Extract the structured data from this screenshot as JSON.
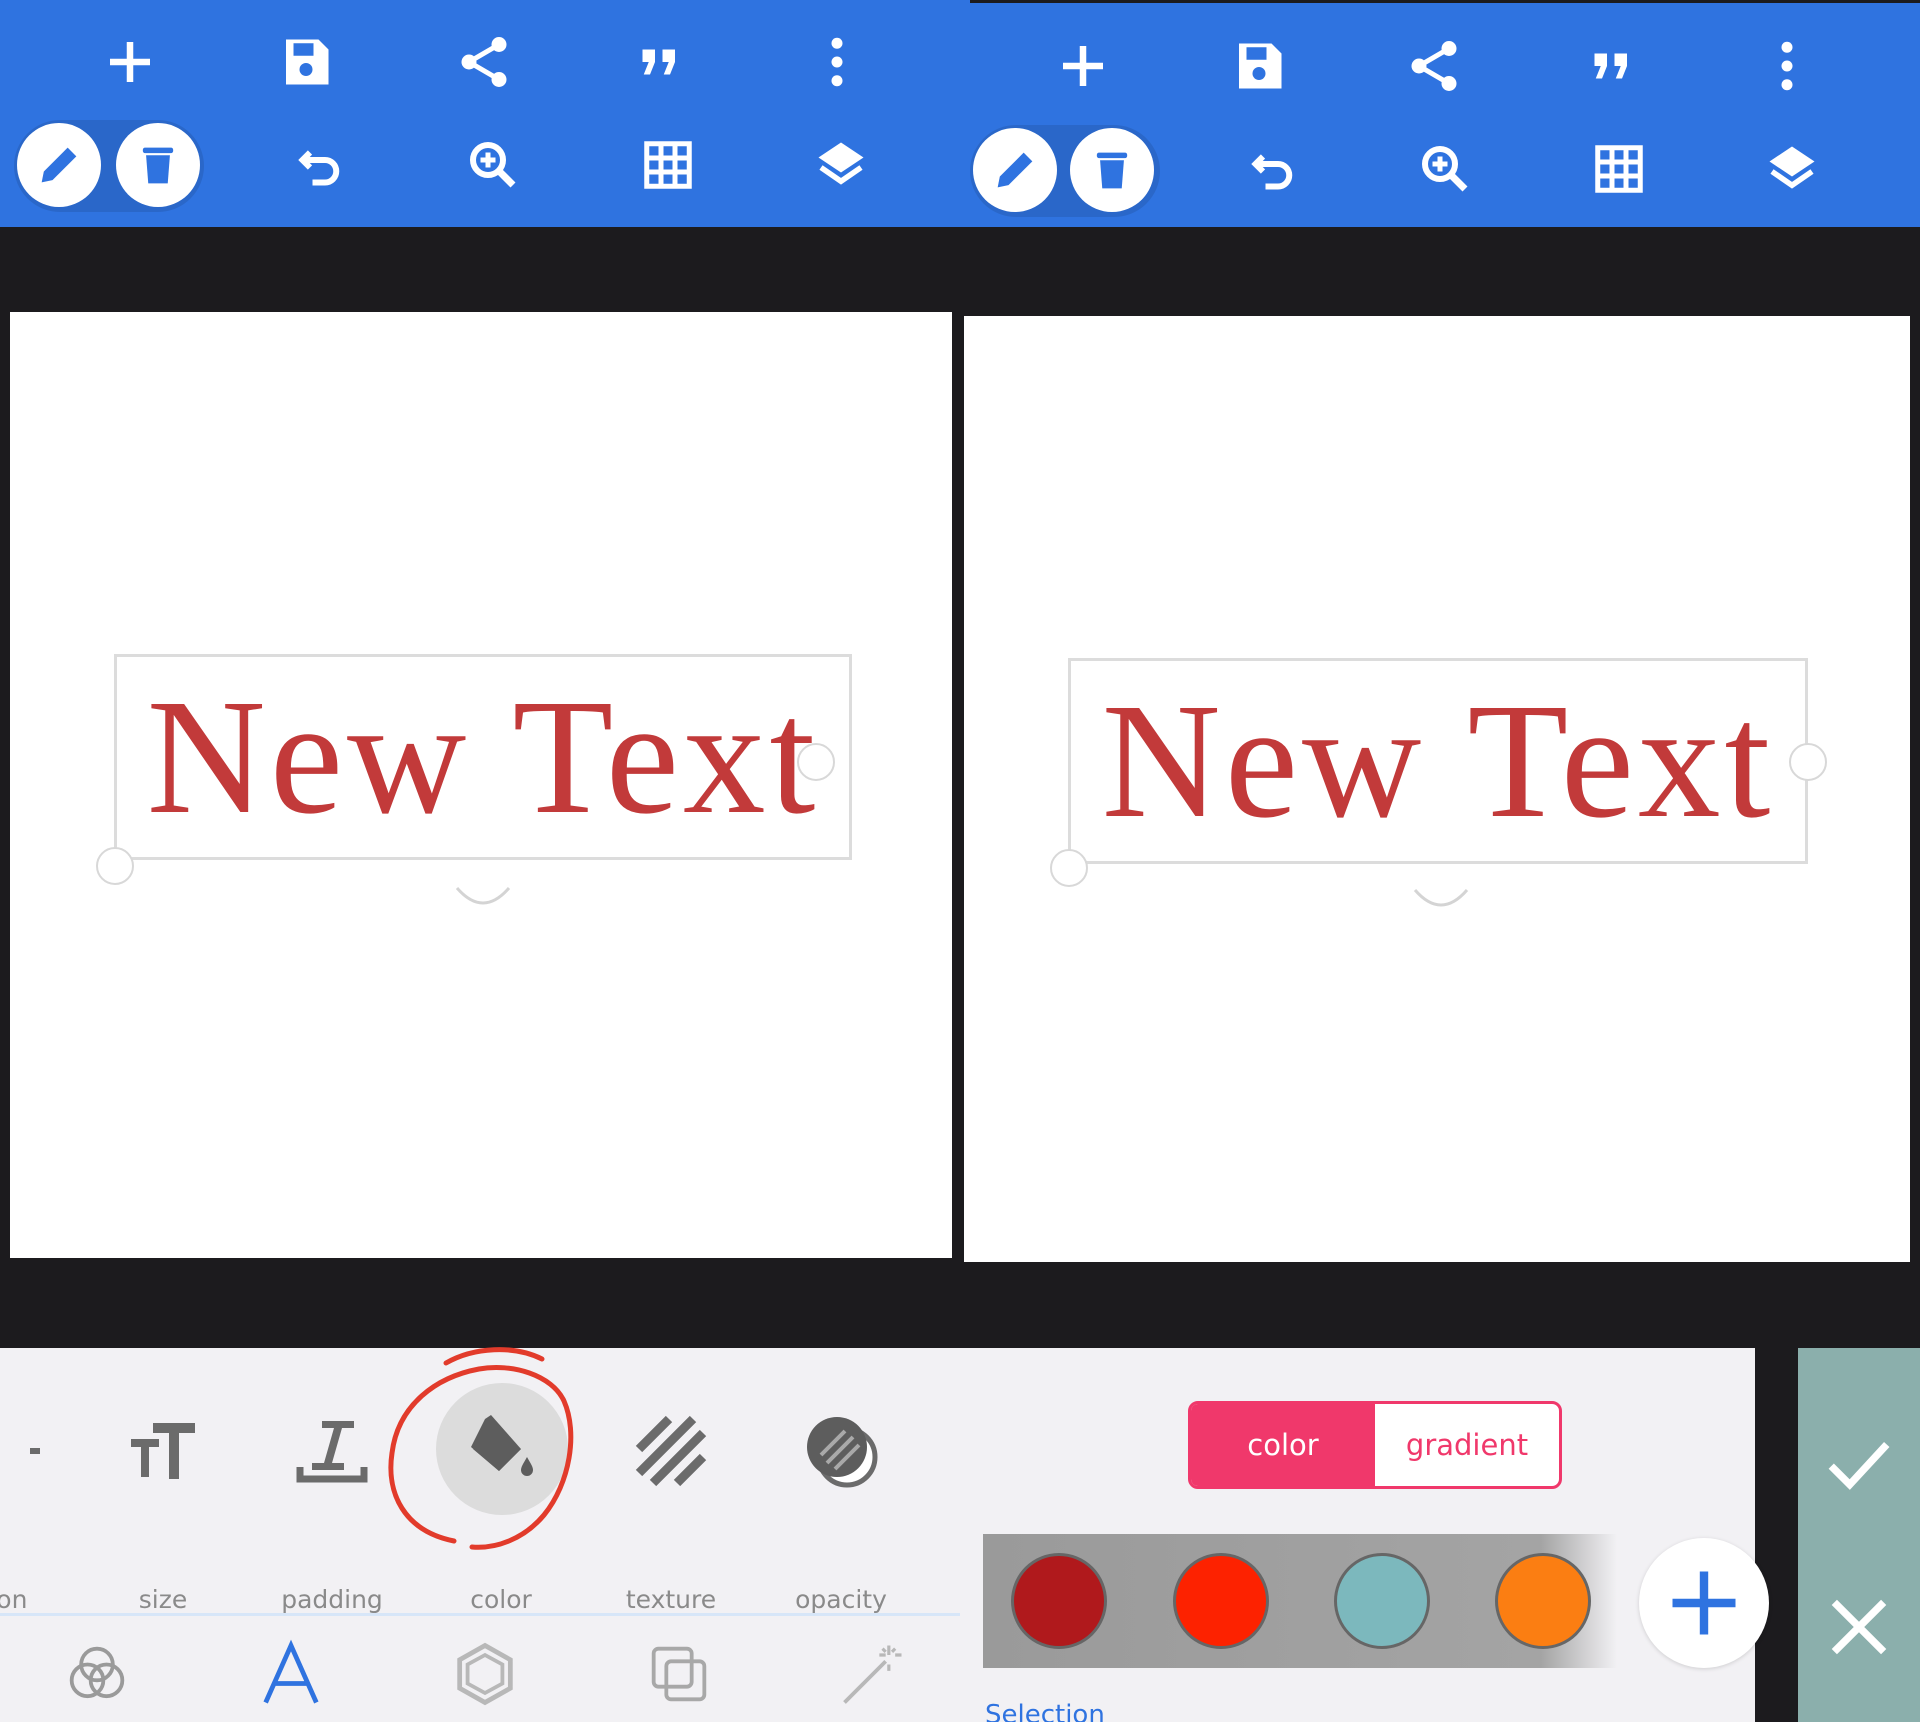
{
  "colors": {
    "toolbar": "#2f73e0",
    "text": "#c23a3a",
    "accent": "#f0386b",
    "confirm_panel": "#8bafac",
    "highlight_circle": "#e23b2b"
  },
  "toolbar": {
    "row1": [
      "add-icon",
      "save-icon",
      "share-icon",
      "quote-icon",
      "more-vert-icon"
    ],
    "row2": [
      "edit-icon",
      "delete-icon",
      "undo-icon",
      "zoom-in-icon",
      "grid-icon",
      "layers-icon"
    ]
  },
  "canvas": {
    "text_layer": "New Text"
  },
  "text_tools": [
    {
      "name": "position",
      "label": "ition"
    },
    {
      "name": "size",
      "label": "size"
    },
    {
      "name": "padding",
      "label": "padding"
    },
    {
      "name": "color",
      "label": "color"
    },
    {
      "name": "texture",
      "label": "texture"
    },
    {
      "name": "opacity",
      "label": "opacity"
    }
  ],
  "bottom_tabs": [
    "blend-icon",
    "text-icon",
    "shape-icon",
    "layer-copy-icon",
    "magic-wand-icon"
  ],
  "color_panel": {
    "mode_tabs": {
      "color": "color",
      "gradient": "gradient"
    },
    "swatches": [
      "#b0191c",
      "#fd2200",
      "#7cb8bd",
      "#fb7e12"
    ],
    "selection_label": "Selection"
  }
}
